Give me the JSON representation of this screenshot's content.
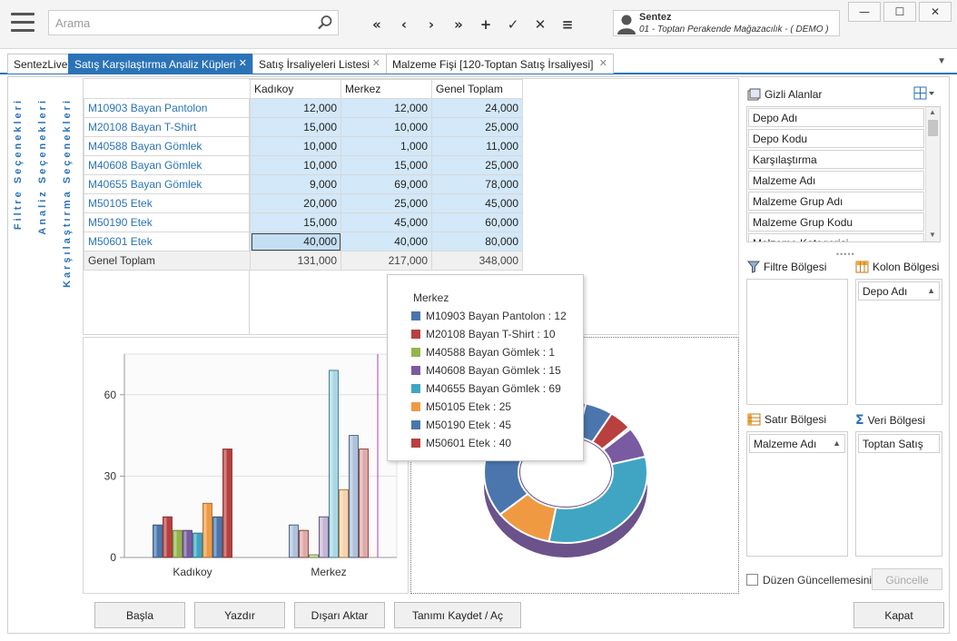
{
  "search": {
    "placeholder": "Arama"
  },
  "nav": [
    "«",
    "‹",
    "›",
    "»",
    "+",
    "✓",
    "✕",
    "≡"
  ],
  "user": {
    "name": "Sentez",
    "company": "01 - Toptan Perakende Mağazacılık - ( DEMO )"
  },
  "window": {
    "minimize": "—",
    "maximize": "☐",
    "close": "✕"
  },
  "tabs": [
    {
      "label": "SentezLive",
      "closable": false,
      "active": false
    },
    {
      "label": "Satış Karşılaştırma Analiz Küpleri",
      "closable": true,
      "active": true
    },
    {
      "label": "Satış İrsaliyeleri Listesi",
      "closable": true,
      "active": false
    },
    {
      "label": "Malzeme Fişi  [120-Toptan Satış İrsaliyesi]",
      "closable": true,
      "active": false
    }
  ],
  "tab_close_glyph": "✕",
  "side_labels": {
    "filtre": "Filtre Seçenekleri",
    "analiz": "Analiz Seçenekleri",
    "karsilastirma": "Karşılaştırma Seçenekleri"
  },
  "pivot": {
    "columns": [
      "Kadıkoy",
      "Merkez",
      "Genel Toplam"
    ],
    "rows": [
      {
        "label": "M10903 Bayan Pantolon",
        "values": [
          "12,000",
          "12,000",
          "24,000"
        ]
      },
      {
        "label": "M20108 Bayan T-Shirt",
        "values": [
          "15,000",
          "10,000",
          "25,000"
        ]
      },
      {
        "label": "M40588 Bayan Gömlek",
        "values": [
          "10,000",
          "1,000",
          "11,000"
        ]
      },
      {
        "label": "M40608 Bayan Gömlek",
        "values": [
          "10,000",
          "15,000",
          "25,000"
        ]
      },
      {
        "label": "M40655 Bayan Gömlek",
        "values": [
          "9,000",
          "69,000",
          "78,000"
        ]
      },
      {
        "label": "M50105 Etek",
        "values": [
          "20,000",
          "25,000",
          "45,000"
        ]
      },
      {
        "label": "M50190 Etek",
        "values": [
          "15,000",
          "45,000",
          "60,000"
        ]
      },
      {
        "label": "M50601 Etek",
        "values": [
          "40,000",
          "40,000",
          "80,000"
        ]
      }
    ],
    "total": {
      "label": "Genel Toplam",
      "values": [
        "131,000",
        "217,000",
        "348,000"
      ]
    }
  },
  "chart_data": {
    "type": "bar",
    "categories": [
      "Kadıkoy",
      "Merkez"
    ],
    "series": [
      {
        "name": "M10903 Bayan Pantolon",
        "values": [
          12,
          12
        ],
        "color": "#4a76ad"
      },
      {
        "name": "M20108 Bayan T-Shirt",
        "values": [
          15,
          10
        ],
        "color": "#b8403f"
      },
      {
        "name": "M40588 Bayan Gömlek",
        "values": [
          10,
          1
        ],
        "color": "#93b54a"
      },
      {
        "name": "M40608 Bayan Gömlek",
        "values": [
          10,
          15
        ],
        "color": "#7a5aa0"
      },
      {
        "name": "M40655 Bayan Gömlek",
        "values": [
          9,
          69
        ],
        "color": "#3fa5c3"
      },
      {
        "name": "M50105 Etek",
        "values": [
          20,
          25
        ],
        "color": "#ef9a43"
      },
      {
        "name": "M50190 Etek",
        "values": [
          15,
          45
        ],
        "color": "#4a76ad"
      },
      {
        "name": "M50601 Etek",
        "values": [
          40,
          40
        ],
        "color": "#b8403f"
      }
    ],
    "yticks": [
      "0",
      "30",
      "60"
    ],
    "ylim": [
      0,
      75
    ],
    "grid": true
  },
  "tooltip": {
    "title": "Merkez",
    "items": [
      {
        "text": "M10903 Bayan Pantolon : 12",
        "color": "#4a76ad"
      },
      {
        "text": "M20108 Bayan T-Shirt : 10",
        "color": "#b8403f"
      },
      {
        "text": "M40588 Bayan Gömlek : 1",
        "color": "#93b54a"
      },
      {
        "text": "M40608 Bayan Gömlek : 15",
        "color": "#7a5aa0"
      },
      {
        "text": "M40655 Bayan Gömlek : 69",
        "color": "#3fa5c3"
      },
      {
        "text": "M50105 Etek : 25",
        "color": "#ef9a43"
      },
      {
        "text": "M50190 Etek : 45",
        "color": "#4a76ad"
      },
      {
        "text": "M50601 Etek : 40",
        "color": "#b8403f"
      }
    ]
  },
  "right_panel": {
    "hidden_title": "Gizli Alanlar",
    "hidden_fields": [
      "Depo Adı",
      "Depo Kodu",
      "Karşılaştırma",
      "Malzeme Adı",
      "Malzeme Grup Adı",
      "Malzeme Grup Kodu",
      "Malzeme Kategorisi"
    ],
    "filter_title": "Filtre Bölgesi",
    "column_title": "Kolon Bölgesi",
    "column_items": [
      "Depo Adı"
    ],
    "row_title": "Satır Bölgesi",
    "row_items": [
      "Malzeme Adı"
    ],
    "data_title": "Veri Bölgesi",
    "data_items": [
      "Toptan Satış"
    ],
    "defer_label": "Düzen Güncellemesini Ertele",
    "update_button": "Güncelle"
  },
  "buttons": {
    "start": "Başla",
    "print": "Yazdır",
    "export": "Dışarı Aktar",
    "save_def": "Tanımı Kaydet / Aç",
    "close": "Kapat"
  }
}
